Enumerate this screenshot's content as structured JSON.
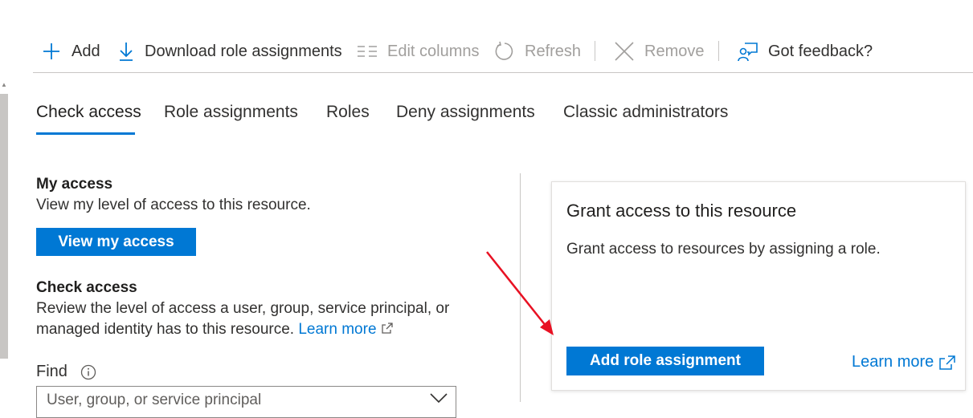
{
  "toolbar": {
    "add": "Add",
    "download": "Download role assignments",
    "edit_columns": "Edit columns",
    "refresh": "Refresh",
    "remove": "Remove",
    "feedback": "Got feedback?"
  },
  "tabs": [
    {
      "label": "Check access",
      "active": true
    },
    {
      "label": "Role assignments",
      "active": false
    },
    {
      "label": "Roles",
      "active": false
    },
    {
      "label": "Deny assignments",
      "active": false
    },
    {
      "label": "Classic administrators",
      "active": false
    }
  ],
  "my_access": {
    "title": "My access",
    "description": "View my level of access to this resource.",
    "button": "View my access"
  },
  "check_access": {
    "title": "Check access",
    "description": "Review the level of access a user, group, service principal, or managed identity has to this resource.",
    "learn_more": "Learn more",
    "find_label": "Find",
    "find_placeholder": "User, group, or service principal"
  },
  "grant_card": {
    "title": "Grant access to this resource",
    "description": "Grant access to resources by assigning a role.",
    "button": "Add role assignment",
    "learn_more": "Learn more"
  },
  "colors": {
    "accent": "#0078d4",
    "annotation_arrow": "#e81123"
  },
  "icons": [
    "plus-icon",
    "download-icon",
    "edit-columns-icon",
    "refresh-icon",
    "remove-icon",
    "feedback-icon",
    "external-link-icon",
    "info-icon",
    "chevron-down-icon"
  ]
}
